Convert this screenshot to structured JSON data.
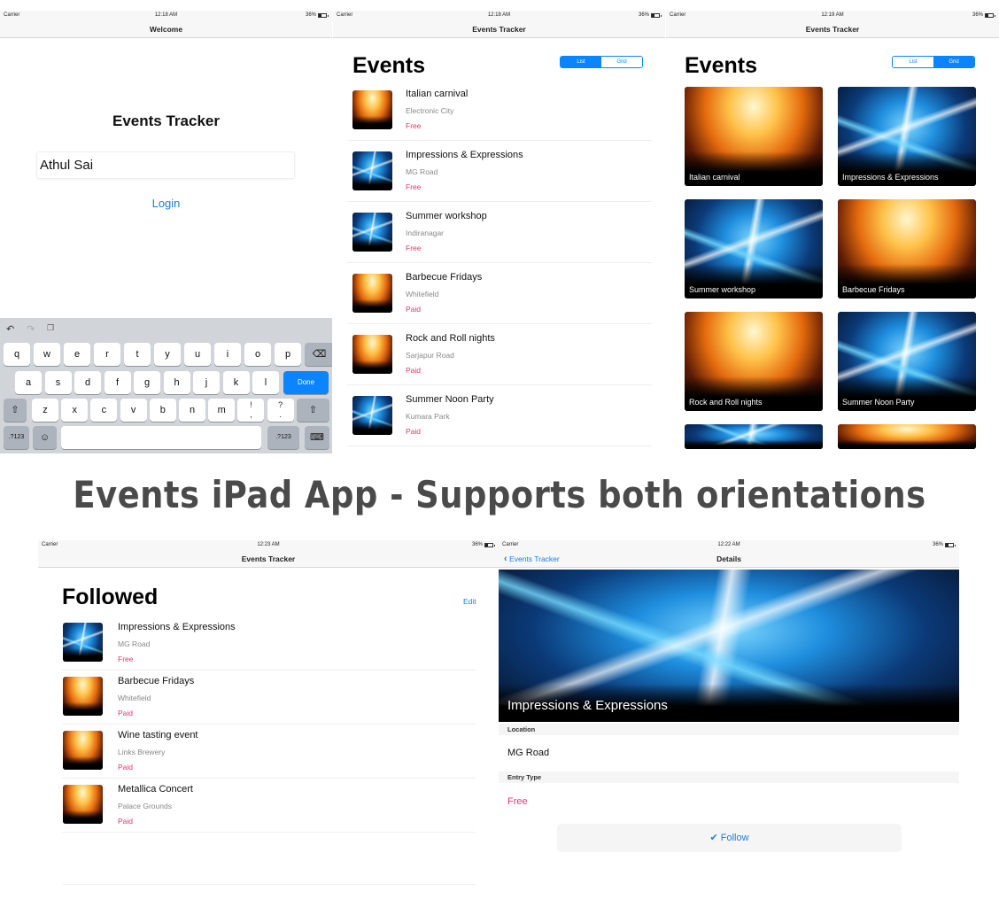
{
  "caption": "Events iPad App - Supports both orientations",
  "colors": {
    "accent": "#0a84ff",
    "link": "#1a7ee0",
    "price": "#e8356a",
    "caption": "#4a4a4a"
  },
  "screens": {
    "login": {
      "status": {
        "carrier": "Carrier",
        "time": "12:18 AM",
        "battery": "36%"
      },
      "nav_title": "Welcome",
      "app_title": "Events Tracker",
      "name_field_value": "Athul Sai",
      "login_label": "Login",
      "keyboard": {
        "toolbar_icons": [
          "undo-icon",
          "redo-icon",
          "paste-icon"
        ],
        "row1": [
          "q",
          "w",
          "e",
          "r",
          "t",
          "y",
          "u",
          "i",
          "o",
          "p"
        ],
        "row2": [
          "a",
          "s",
          "d",
          "f",
          "g",
          "h",
          "j",
          "k",
          "l"
        ],
        "row3": [
          "z",
          "x",
          "c",
          "v",
          "b",
          "n",
          "m",
          "!\n,",
          "?\n."
        ],
        "done_label": "Done",
        "numbers_label": ".?123",
        "shift_glyph": "⇧",
        "delete_glyph": "⌫",
        "emoji_glyph": "☺",
        "hide_glyph": "⌨"
      }
    },
    "list": {
      "status": {
        "carrier": "Carrier",
        "time": "12:18 AM",
        "battery": "36%"
      },
      "nav_title": "Events Tracker",
      "title": "Events",
      "segments": [
        "List",
        "Grid"
      ],
      "selected_segment": "List",
      "events": [
        {
          "title": "Italian carnival",
          "location": "Electronic City",
          "price": "Free",
          "image": "orange"
        },
        {
          "title": "Impressions & Expressions",
          "location": "MG Road",
          "price": "Free",
          "image": "blue"
        },
        {
          "title": "Summer workshop",
          "location": "Indiranagar",
          "price": "Free",
          "image": "blue"
        },
        {
          "title": "Barbecue Fridays",
          "location": "Whitefield",
          "price": "Paid",
          "image": "orange"
        },
        {
          "title": "Rock and Roll nights",
          "location": "Sarjapur Road",
          "price": "Paid",
          "image": "orange"
        },
        {
          "title": "Summer Noon Party",
          "location": "Kumara Park",
          "price": "Paid",
          "image": "blue"
        }
      ]
    },
    "grid": {
      "status": {
        "carrier": "Carrier",
        "time": "12:19 AM",
        "battery": "36%"
      },
      "nav_title": "Events Tracker",
      "title": "Events",
      "segments": [
        "List",
        "Grid"
      ],
      "selected_segment": "Grid",
      "cards": [
        {
          "title": "Italian carnival",
          "image": "orange"
        },
        {
          "title": "Impressions & Expressions",
          "image": "blue"
        },
        {
          "title": "Summer workshop",
          "image": "blue"
        },
        {
          "title": "Barbecue Fridays",
          "image": "orange"
        },
        {
          "title": "Rock and Roll nights",
          "image": "orange"
        },
        {
          "title": "Summer Noon Party",
          "image": "blue"
        },
        {
          "title": "",
          "image": "blue"
        },
        {
          "title": "",
          "image": "orange"
        }
      ]
    },
    "followed": {
      "status": {
        "carrier": "Carrier",
        "time": "12:23 AM",
        "battery": "36%"
      },
      "nav_title": "Events Tracker",
      "title": "Followed",
      "edit_label": "Edit",
      "events": [
        {
          "title": "Impressions & Expressions",
          "location": "MG Road",
          "price": "Free",
          "image": "blue"
        },
        {
          "title": "Barbecue Fridays",
          "location": "Whitefield",
          "price": "Paid",
          "image": "orange"
        },
        {
          "title": "Wine tasting event",
          "location": "Links Brewery",
          "price": "Paid",
          "image": "orange"
        },
        {
          "title": "Metallica Concert",
          "location": "Palace Grounds",
          "price": "Paid",
          "image": "orange"
        }
      ]
    },
    "details": {
      "status": {
        "carrier": "Carrier",
        "time": "12:22 AM",
        "battery": "36%"
      },
      "back_label": "Events Tracker",
      "nav_title": "Details",
      "event_title": "Impressions & Expressions",
      "location_header": "Location",
      "location_value": "MG Road",
      "entry_header": "Entry Type",
      "entry_value": "Free",
      "follow_label": "✔ Follow"
    }
  }
}
